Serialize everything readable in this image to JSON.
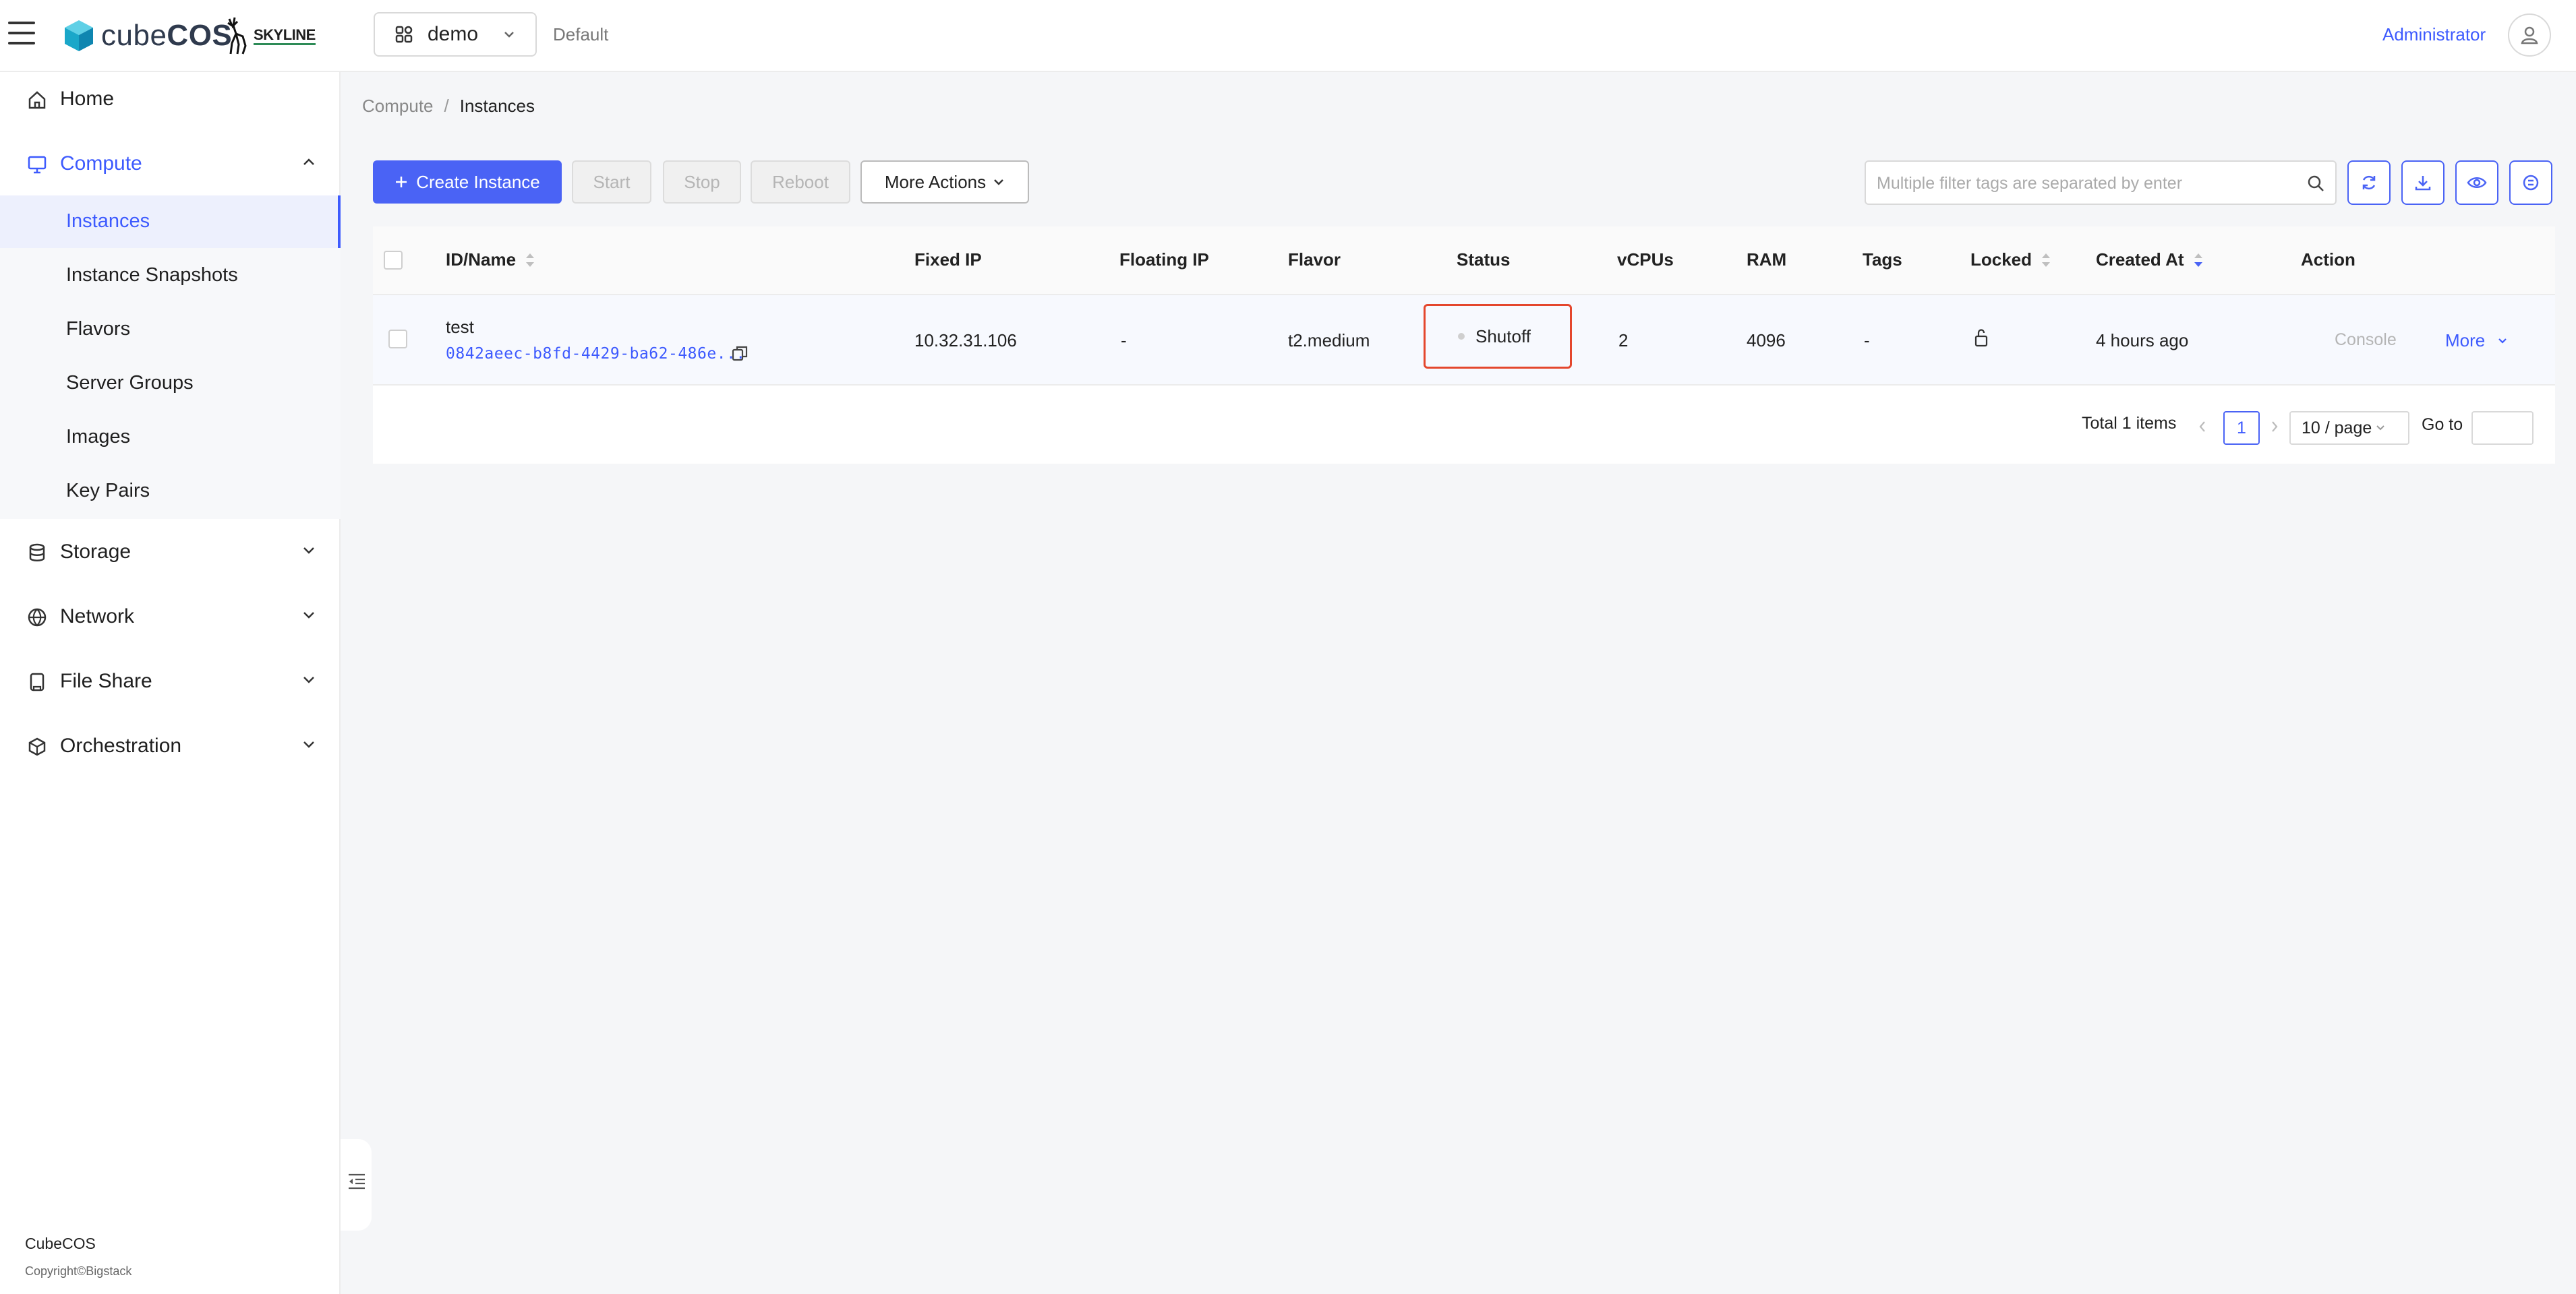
{
  "header": {
    "logo_prefix": "cube",
    "logo_suffix": "COS",
    "partner_logo": "SKYLINE",
    "project": "demo",
    "domain": "Default",
    "user": "Administrator"
  },
  "sidebar": {
    "items": [
      {
        "label": "Home",
        "icon": "home-icon"
      },
      {
        "label": "Compute",
        "icon": "monitor-icon",
        "expanded": true
      },
      {
        "label": "Storage",
        "icon": "database-icon"
      },
      {
        "label": "Network",
        "icon": "globe-icon"
      },
      {
        "label": "File Share",
        "icon": "file-share-icon"
      },
      {
        "label": "Orchestration",
        "icon": "orchestration-icon"
      }
    ],
    "compute_sub": [
      "Instances",
      "Instance Snapshots",
      "Flavors",
      "Server Groups",
      "Images",
      "Key Pairs"
    ],
    "selected": "Instances",
    "footer_brand": "CubeCOS",
    "footer_copy": "Copyright©Bigstack"
  },
  "breadcrumb": {
    "parent": "Compute",
    "current": "Instances",
    "separator": "/"
  },
  "toolbar": {
    "create": "Create Instance",
    "start": "Start",
    "stop": "Stop",
    "reboot": "Reboot",
    "more_actions": "More Actions",
    "search_placeholder": "Multiple filter tags are separated by enter"
  },
  "table": {
    "columns": {
      "id_name": "ID/Name",
      "fixed_ip": "Fixed IP",
      "floating_ip": "Floating IP",
      "flavor": "Flavor",
      "status": "Status",
      "vcpus": "vCPUs",
      "ram": "RAM",
      "tags": "Tags",
      "locked": "Locked",
      "created_at": "Created At",
      "action": "Action"
    },
    "rows": [
      {
        "name": "test",
        "id": "0842aeec-b8fd-4429-ba62-486e...",
        "fixed_ip": "10.32.31.106",
        "floating_ip": "-",
        "flavor": "t2.medium",
        "status": "Shutoff",
        "vcpus": "2",
        "ram": "4096",
        "tags": "-",
        "created_at": "4 hours ago",
        "console": "Console",
        "more": "More"
      }
    ]
  },
  "pagination": {
    "total": "Total 1 items",
    "current_page": "1",
    "page_size": "10 / page",
    "goto_label": "Go to"
  },
  "colors": {
    "accent": "#4a63f5",
    "status_outline": "#e4472d"
  }
}
